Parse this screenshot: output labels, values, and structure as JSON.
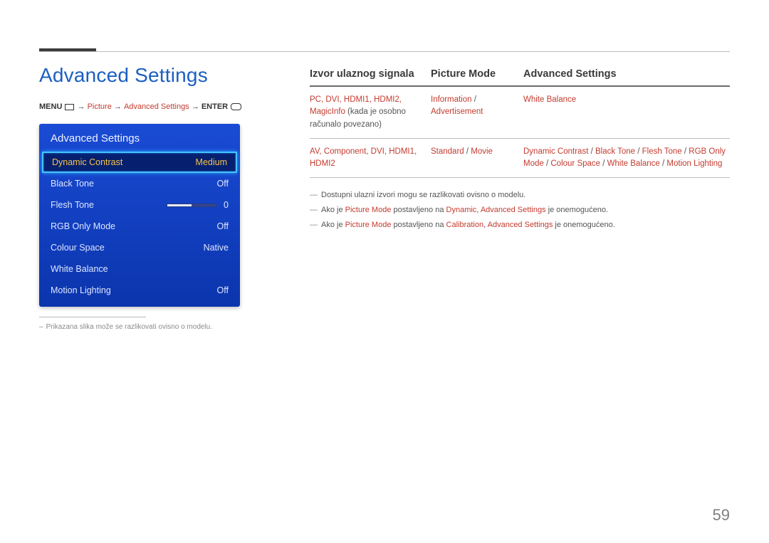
{
  "page_number": "59",
  "heading": "Advanced Settings",
  "breadcrumb": {
    "menu": "MENU",
    "arrow": "→",
    "p1": "Picture",
    "p2": "Advanced Settings",
    "enter": "ENTER"
  },
  "osd": {
    "title": "Advanced Settings",
    "rows": [
      {
        "label": "Dynamic Contrast",
        "value": "Medium",
        "selected": true
      },
      {
        "label": "Black Tone",
        "value": "Off"
      },
      {
        "label": "Flesh Tone",
        "value": "0",
        "slider": 50
      },
      {
        "label": "RGB Only Mode",
        "value": "Off"
      },
      {
        "label": "Colour Space",
        "value": "Native"
      },
      {
        "label": "White Balance",
        "value": ""
      },
      {
        "label": "Motion Lighting",
        "value": "Off"
      }
    ]
  },
  "foot_note": "Prikazana slika može se razlikovati ovisno o modelu.",
  "table": {
    "headers": {
      "c1": "Izvor ulaznog signala",
      "c2": "Picture Mode",
      "c3": "Advanced Settings"
    },
    "row1": {
      "c1a": "PC, DVI, HDMI1, HDMI2,",
      "c1b_hl": "MagicInfo",
      "c1b_plain": " (kada je osobno računalo povezano)",
      "c2a": "Information",
      "c2sep": " / ",
      "c2b": "Advertisement",
      "c3": "White Balance"
    },
    "row2": {
      "c1a": "AV, Component, DVI, HDMI1, HDMI2",
      "c2a": "Standard",
      "c2sep": " / ",
      "c2b": "Movie",
      "c3_parts": [
        "Dynamic Contrast",
        " / ",
        "Black Tone",
        " / ",
        "Flesh Tone",
        " / ",
        "RGB Only Mode",
        " / ",
        "Colour Space",
        " / ",
        "White Balance",
        " / ",
        "Motion Lighting"
      ]
    }
  },
  "notes": {
    "n1": "Dostupni ulazni izvori mogu se razlikovati ovisno o modelu.",
    "n2_pre": "Ako je ",
    "n2_a": "Picture Mode",
    "n2_mid": " postavljeno na ",
    "n2_b": "Dynamic",
    "n2_sep": ", ",
    "n2_c": "Advanced Settings",
    "n2_post": " je onemogućeno.",
    "n3_pre": "Ako je ",
    "n3_a": "Picture Mode",
    "n3_mid": " postavljeno na ",
    "n3_b": "Calibration",
    "n3_sep": ", ",
    "n3_c": "Advanced Settings",
    "n3_post": " je onemogućeno."
  }
}
